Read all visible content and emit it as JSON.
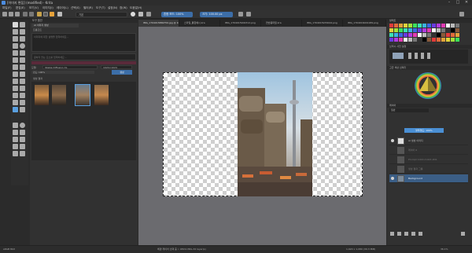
{
  "window": {
    "title": "[이미지 편집] (modified) - Krita",
    "controls": [
      "–",
      "□",
      "✕"
    ]
  },
  "menu": [
    "파일(F)",
    "편집(E)",
    "보기(V)",
    "이미지(I)",
    "레이어(L)",
    "선택(S)",
    "필터(R)",
    "도구(T)",
    "설정(N)",
    "창(W)",
    "도움말(H)"
  ],
  "toolbar": {
    "brush_preset": "기본",
    "blend_mode": "Normal",
    "blend_mode_label": "혼합 모드: 100%",
    "opacity_label": "불투명도: 100%",
    "size_label": "크기: 100.00 px"
  },
  "tabs": [
    "IMG_1704015869750.jpg @ 100%",
    "스타일_통합예시.kra",
    "IMG_1704015902312.png",
    "연습용파일.kra",
    "IMG_1704015970044.png",
    "IMG_1704016001189.png"
  ],
  "left_panel": {
    "header": "도구 옵션",
    "prompt_tab": "AI 이미지 생성",
    "prompt_label": "프롬프트",
    "prompt_placeholder": "이미지에 대한 설명을 입력하세요...",
    "negative_placeholder": "원하지 않는 요소를 입력하세요...",
    "model_label": "모델:",
    "model_value": "Stable Diffusion XL",
    "size_label": "크기:",
    "size_value": "1024×1024",
    "strength_label": "강도: 100%",
    "generate_button": "생성",
    "history_label": "생성 결과",
    "thumbnails_count": 4
  },
  "canvas": {
    "status": "배경 레이어 선택 중 ∙ 캔버스: 4819×8KL-32 layer(s)"
  },
  "right_panel": {
    "palette_header": "팔레트",
    "brush_header": "브러시 사전 설정",
    "color_header": "고급 색상 선택기",
    "layers_header": "레이어",
    "blend_value": "일반",
    "opacity_value": "불투명도: 100%",
    "layers": [
      {
        "name": "AI 생성 이미지",
        "visible": true
      },
      {
        "name": "레이어 6",
        "visible": false
      },
      {
        "name": "Prompt 1024×1024 #01",
        "visible": false
      },
      {
        "name": "생성 결과 그룹",
        "visible": false
      },
      {
        "name": "Background",
        "visible": true
      }
    ],
    "accent_color": "#4a8fd4"
  },
  "status_bar": {
    "left": "sRGB 8bit",
    "center": "배경 레이어 선택 중 ∙ 4819×8KL-32 layer(s)",
    "right": "1,920 x 1,080 (39.3 MiB)",
    "zoom": "36.1%"
  }
}
